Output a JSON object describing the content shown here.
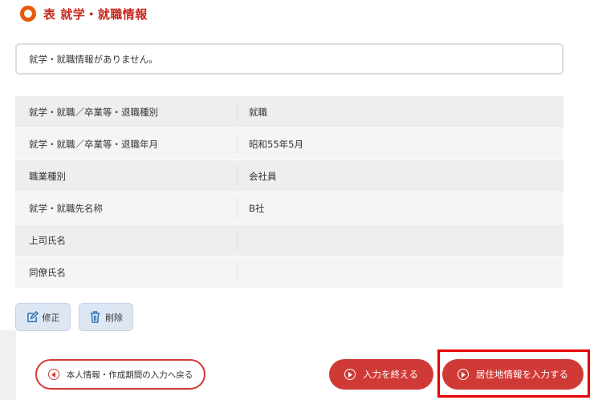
{
  "header": {
    "title": "表 就学・就職情報"
  },
  "notice": {
    "text": "就学・就職情報がありません。"
  },
  "table": {
    "rows": [
      {
        "label": "就学・就職／卒業等・退職種別",
        "value": "就職"
      },
      {
        "label": "就学・就職／卒業等・退職年月",
        "value": "昭和55年5月"
      },
      {
        "label": "職業種別",
        "value": "会社員"
      },
      {
        "label": "就学・就職先名称",
        "value": "B社"
      },
      {
        "label": "上司氏名",
        "value": ""
      },
      {
        "label": "同僚氏名",
        "value": ""
      }
    ]
  },
  "actions": {
    "edit_label": "修正",
    "delete_label": "削除"
  },
  "footer": {
    "back_label": "本人情報・作成期間の入力へ戻る",
    "end_label": "入力を終える",
    "next_label": "居住地情報を入力する"
  },
  "colors": {
    "accent": "#d03a36",
    "title": "#c6281e",
    "ring": "#e85a0c",
    "highlight": "#e60000"
  }
}
